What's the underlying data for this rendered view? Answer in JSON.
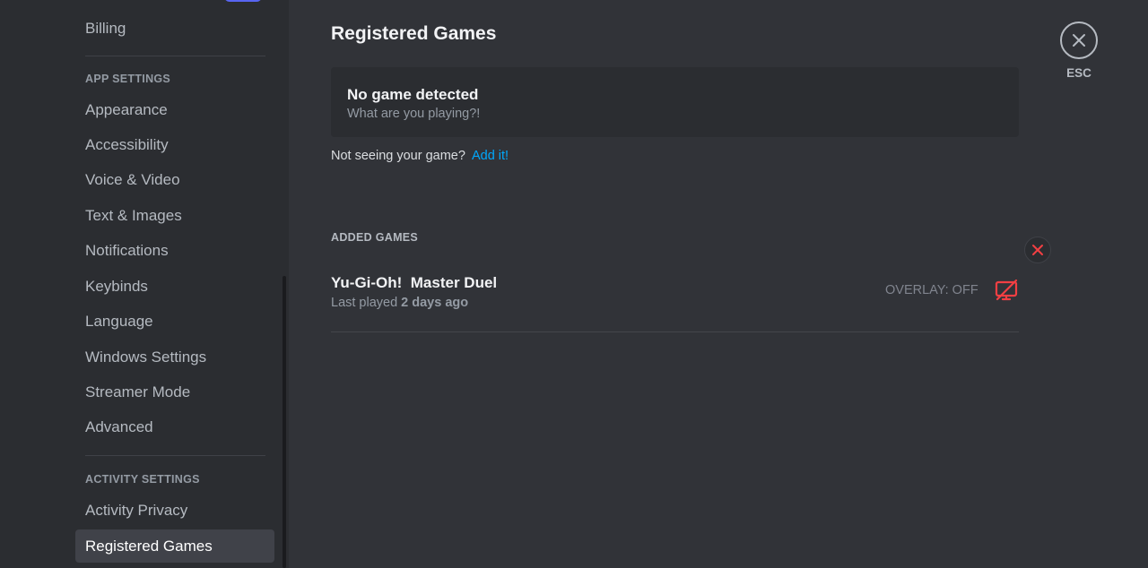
{
  "sidebar": {
    "billing": "Billing",
    "app_settings_header": "APP SETTINGS",
    "app_items": [
      {
        "label": "Appearance"
      },
      {
        "label": "Accessibility"
      },
      {
        "label": "Voice & Video"
      },
      {
        "label": "Text & Images"
      },
      {
        "label": "Notifications"
      },
      {
        "label": "Keybinds"
      },
      {
        "label": "Language"
      },
      {
        "label": "Windows Settings"
      },
      {
        "label": "Streamer Mode"
      },
      {
        "label": "Advanced"
      }
    ],
    "activity_settings_header": "ACTIVITY SETTINGS",
    "activity_items": [
      {
        "label": "Activity Privacy"
      },
      {
        "label": "Registered Games",
        "selected": true
      }
    ]
  },
  "main": {
    "title": "Registered Games",
    "detect_box": {
      "title": "No game detected",
      "subtitle": "What are you playing?!"
    },
    "not_seeing_text": "Not seeing your game?",
    "add_link": "Add it!",
    "added_games_header": "ADDED GAMES",
    "games": [
      {
        "name": "Yu-Gi-Oh!  Master Duel",
        "last_played_label": "Last played",
        "last_played_time": "2 days ago",
        "overlay_status": "OVERLAY: OFF",
        "overlay_icon": "overlay-off-icon"
      }
    ]
  },
  "close": {
    "label": "ESC",
    "icon": "close-icon"
  },
  "colors": {
    "sidebar_bg": "#2b2d31",
    "main_bg": "#313338",
    "selected_bg": "#404249",
    "link": "#00a8fc",
    "danger": "#f23f43",
    "brand": "#5865f2"
  }
}
